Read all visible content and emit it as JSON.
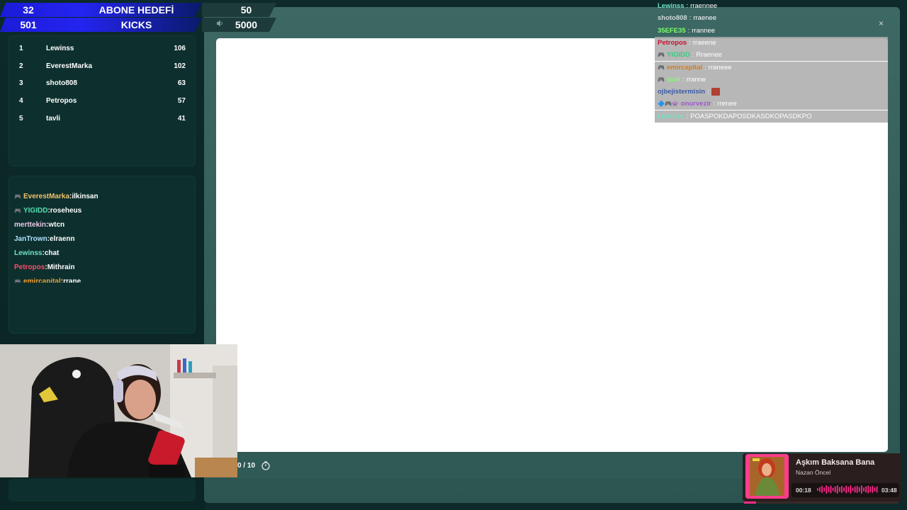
{
  "top_bars": {
    "subscriber_goal": {
      "count": "32",
      "title": "ABONE HEDEFİ",
      "goal": "50"
    },
    "kicks": {
      "count": "501",
      "title": "KICKS",
      "goal": "5000"
    }
  },
  "leaderboard": [
    {
      "rank": "1",
      "name": "Lewinss",
      "score": "106"
    },
    {
      "rank": "2",
      "name": "EverestMarka",
      "score": "102"
    },
    {
      "rank": "3",
      "name": "shoto808",
      "score": "63"
    },
    {
      "rank": "4",
      "name": "Petropos",
      "score": "57"
    },
    {
      "rank": "5",
      "name": "tavli",
      "score": "41"
    }
  ],
  "side_chat": [
    {
      "badge": "🎮",
      "user": "EverestMarka",
      "msg": "ilkinsan",
      "color": "#f5c26b"
    },
    {
      "badge": "🎮",
      "user": "YIGIDD",
      "msg": "roseheus",
      "color": "#55e0b0"
    },
    {
      "badge": "",
      "user": "merttekin",
      "msg": "wtcn",
      "color": "#e8c8e8"
    },
    {
      "badge": "",
      "user": "JanTrown",
      "msg": "elraenn",
      "color": "#aee0ff"
    },
    {
      "badge": "",
      "user": "Lewinss",
      "msg": "chat",
      "color": "#6fe3c4"
    },
    {
      "badge": "",
      "user": "Petropos",
      "msg": "Mithrain",
      "color": "#ff4a6a"
    },
    {
      "badge": "🎮",
      "user": "emircapital",
      "msg": "rrane",
      "color": "#f0a030"
    }
  ],
  "overlay_chat": [
    {
      "user": "Lewinss",
      "msg": "rraennee",
      "color": "#6fe3c4",
      "badge": "",
      "gray": false
    },
    {
      "user": "shoto808",
      "msg": "rraenee",
      "color": "#cfd8d8",
      "badge": "",
      "gray": false
    },
    {
      "user": "35EFE35",
      "msg": "rrannee",
      "color": "#7dff6a",
      "badge": "",
      "gray": false
    },
    {
      "user": "Petropos",
      "msg": "rraeene",
      "color": "#c8102e",
      "badge": "",
      "gray": true
    },
    {
      "user": "YIGIDD",
      "msg": "Rraenee",
      "color": "#2fd080",
      "badge": "🎮",
      "gray": true
    },
    {
      "user": "emircapital",
      "msg": "rraneee",
      "color": "#e07a10",
      "badge": "🎮",
      "gray": true
    },
    {
      "user": "tavli",
      "msg": "rranne",
      "color": "#7dff6a",
      "badge": "🎮",
      "gray": true
    },
    {
      "user": "ojbejistermisin",
      "msg": "",
      "color": "#3a5aa8",
      "badge": "",
      "gray": true,
      "emote": true
    },
    {
      "user": "onurvezir",
      "msg": "rrenee",
      "color": "#9a5ac8",
      "badge": "🔷🎮👾",
      "gray": true
    },
    {
      "user": "Lewinss",
      "msg": "POASPOKDAPOSDKASDKOPASDKPO",
      "color": "#6fe3c4",
      "badge": "",
      "gray": true
    }
  ],
  "overlay_chat_separator": ":",
  "close_icon": "×",
  "quiz": {
    "counter": "0 / 10"
  },
  "music": {
    "title": "Aşkım Baksana Bana",
    "artist": "Nazan Öncel",
    "current_time": "00:18",
    "total_time": "03:48",
    "progress": 0.08,
    "accent": "#ff2a8a"
  }
}
